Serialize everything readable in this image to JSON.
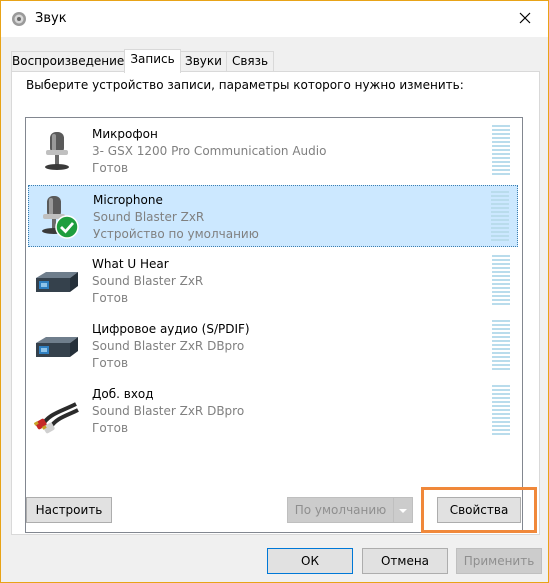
{
  "window": {
    "title": "Звук"
  },
  "tabs": [
    {
      "label": "Воспроизведение"
    },
    {
      "label": "Запись"
    },
    {
      "label": "Звуки"
    },
    {
      "label": "Связь"
    }
  ],
  "instruction": "Выберите устройство записи, параметры которого нужно изменить:",
  "devices": [
    {
      "name": "Микрофон",
      "sub": "3- GSX 1200 Pro Communication Audio",
      "status": "Готов",
      "icon": "microphone-icon",
      "selected": false
    },
    {
      "name": "Microphone",
      "sub": "Sound Blaster ZxR",
      "status": "Устройство по умолчанию",
      "icon": "microphone-default-icon",
      "selected": true
    },
    {
      "name": "What U Hear",
      "sub": "Sound Blaster ZxR",
      "status": "Готов",
      "icon": "sound-card-icon",
      "selected": false
    },
    {
      "name": "Цифровое аудио (S/PDIF)",
      "sub": "Sound Blaster ZxR DBpro",
      "status": "Готов",
      "icon": "sound-card-icon",
      "selected": false
    },
    {
      "name": "Доб. вход",
      "sub": "Sound Blaster ZxR DBpro",
      "status": "Готов",
      "icon": "rca-cable-icon",
      "selected": false
    }
  ],
  "buttons": {
    "configure": "Настроить",
    "set_default": "По умолчанию",
    "properties": "Свойства",
    "ok": "ОК",
    "cancel": "Отмена",
    "apply": "Применить"
  },
  "colors": {
    "selection": "#cce8ff",
    "highlight_frame": "#f0883a",
    "meter": "#b9dcec"
  }
}
